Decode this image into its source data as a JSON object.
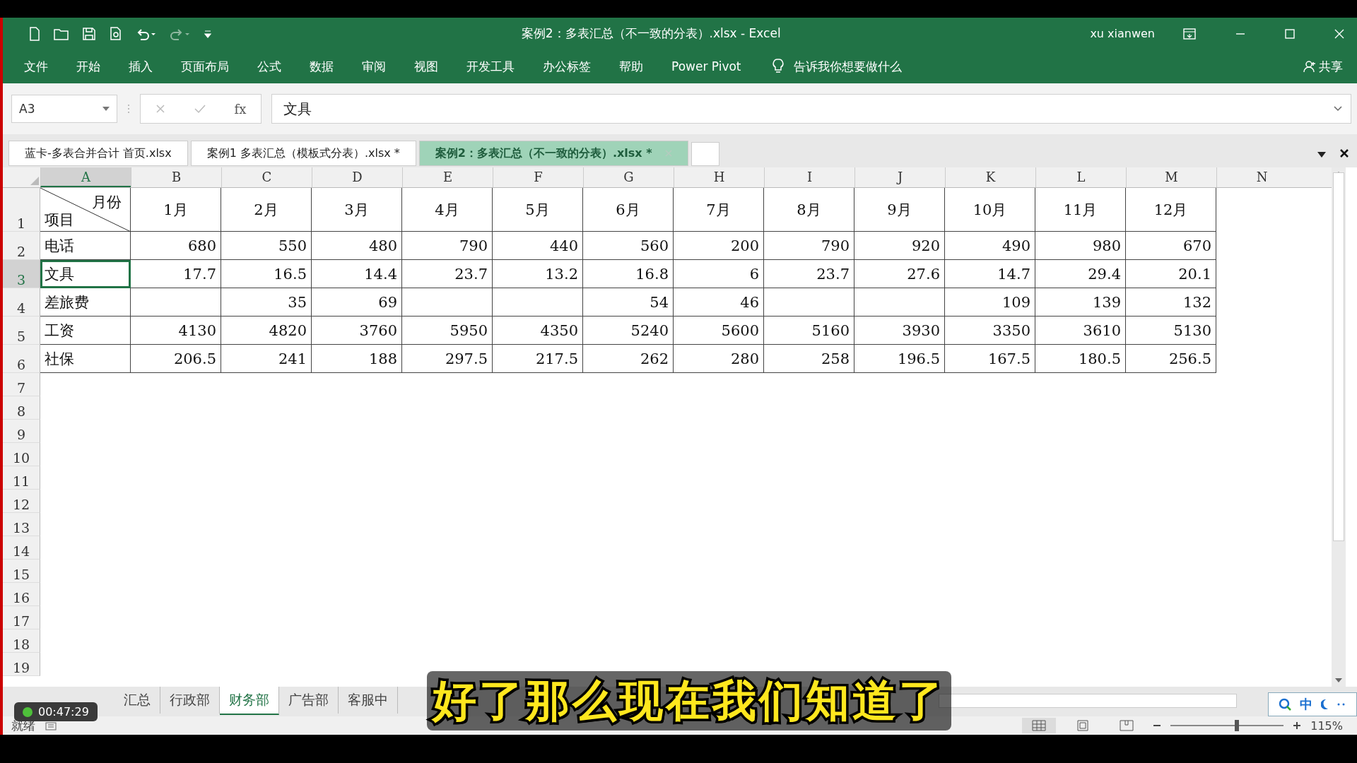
{
  "window": {
    "title": "案例2：多表汇总（不一致的分表）.xlsx  -  Excel",
    "user": "xu xianwen"
  },
  "ribbon_tabs": [
    "文件",
    "开始",
    "插入",
    "页面布局",
    "公式",
    "数据",
    "审阅",
    "视图",
    "开发工具",
    "办公标签",
    "帮助",
    "Power Pivot"
  ],
  "tell_me": "告诉我你想要做什么",
  "share": "共享",
  "formula_bar": {
    "name_box": "A3",
    "value": "文具"
  },
  "workbook_tabs": [
    {
      "label": "蓝卡-多表合并合计 首页.xlsx",
      "selected": false
    },
    {
      "label": "案例1 多表汇总（模板式分表）.xlsx *",
      "selected": false
    },
    {
      "label": "案例2：多表汇总（不一致的分表）.xlsx *",
      "selected": true
    }
  ],
  "sheet": {
    "columns": [
      "A",
      "B",
      "C",
      "D",
      "E",
      "F",
      "G",
      "H",
      "I",
      "J",
      "K",
      "L",
      "M",
      "N"
    ],
    "header_row": {
      "number": "1",
      "corner_top": "月份",
      "corner_bottom": "项目",
      "months": [
        "1月",
        "2月",
        "3月",
        "4月",
        "5月",
        "6月",
        "7月",
        "8月",
        "9月",
        "10月",
        "11月",
        "12月"
      ]
    },
    "rows": [
      {
        "number": "2",
        "label": "电话",
        "selected": false,
        "values": [
          "680",
          "550",
          "480",
          "790",
          "440",
          "560",
          "200",
          "790",
          "920",
          "490",
          "980",
          "670"
        ]
      },
      {
        "number": "3",
        "label": "文具",
        "selected": true,
        "values": [
          "17.7",
          "16.5",
          "14.4",
          "23.7",
          "13.2",
          "16.8",
          "6",
          "23.7",
          "27.6",
          "14.7",
          "29.4",
          "20.1"
        ]
      },
      {
        "number": "4",
        "label": "差旅费",
        "selected": false,
        "cells": {
          "C": "35",
          "D": "69",
          "G": "54",
          "H": "46",
          "K": "109",
          "L": "139",
          "M": "132"
        }
      },
      {
        "number": "5",
        "label": "工资",
        "selected": false,
        "values": [
          "4130",
          "4820",
          "3760",
          "5950",
          "4350",
          "5240",
          "5600",
          "5160",
          "3930",
          "3350",
          "3610",
          "5130"
        ]
      },
      {
        "number": "6",
        "label": "社保",
        "selected": false,
        "values": [
          "206.5",
          "241",
          "188",
          "297.5",
          "217.5",
          "262",
          "280",
          "258",
          "196.5",
          "167.5",
          "180.5",
          "256.5"
        ]
      }
    ],
    "empty_rows": [
      "7",
      "8",
      "9",
      "10",
      "11",
      "12",
      "13",
      "14",
      "15",
      "16",
      "17",
      "18",
      "19"
    ]
  },
  "sheet_tabs": [
    {
      "label": "汇总",
      "selected": false
    },
    {
      "label": "行政部",
      "selected": false
    },
    {
      "label": "财务部",
      "selected": true
    },
    {
      "label": "广告部",
      "selected": false
    },
    {
      "label": "客服中",
      "selected": false
    }
  ],
  "function_button": "fx",
  "zoom_slider": {
    "level": 0.57
  },
  "status": "就绪",
  "zoom": "115%",
  "timer": "00:47:29",
  "ime": "中",
  "subtitle": "好了那么现在我们知道了"
}
